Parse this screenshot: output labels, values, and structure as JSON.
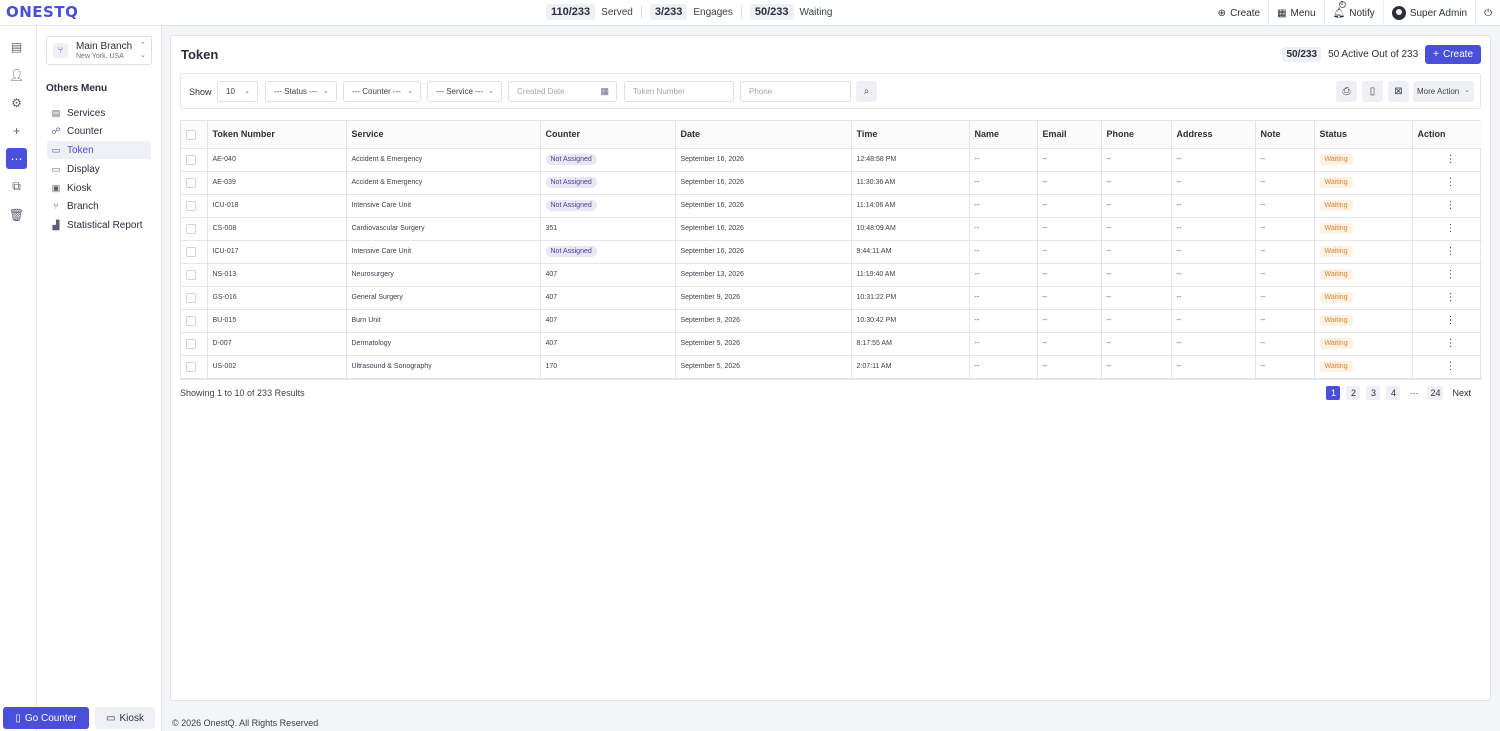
{
  "app": {
    "logo": "ONESTQ"
  },
  "topbar": {
    "stats": [
      {
        "value": "110/233",
        "label": "Served"
      },
      {
        "value": "3/233",
        "label": "Engages"
      },
      {
        "value": "50/233",
        "label": "Waiting"
      }
    ],
    "actions": {
      "create": "Create",
      "menu": "Menu",
      "notify": "Notify",
      "notify_count": "0",
      "user": "Super Admin"
    }
  },
  "branch": {
    "name": "Main Branch",
    "location": "New York, USA"
  },
  "sidebar": {
    "heading": "Others Menu",
    "items": [
      {
        "label": "Services",
        "icon": "services-icon"
      },
      {
        "label": "Counter",
        "icon": "counter-icon"
      },
      {
        "label": "Token",
        "icon": "token-icon",
        "active": true
      },
      {
        "label": "Display",
        "icon": "display-icon"
      },
      {
        "label": "Kiosk",
        "icon": "kiosk-icon"
      },
      {
        "label": "Branch",
        "icon": "branch-icon"
      },
      {
        "label": "Statistical Report",
        "icon": "report-icon"
      }
    ],
    "go_counter": "Go Counter",
    "kiosk": "Kiosk"
  },
  "page": {
    "title": "Token",
    "active_count": "50/233",
    "active_label": "50 Active Out of 233",
    "create": "Create"
  },
  "filters": {
    "show_label": "Show",
    "show_value": "10",
    "status": "--- Status ---",
    "counter": "--- Counter ---",
    "service": "--- Service ---",
    "created_date_placeholder": "Created Date",
    "token_placeholder": "Token Number",
    "phone_placeholder": "Phone",
    "more_action": "More Action"
  },
  "table": {
    "columns": [
      "Token Number",
      "Service",
      "Counter",
      "Date",
      "Time",
      "Name",
      "Email",
      "Phone",
      "Address",
      "Note",
      "Status",
      "Action"
    ],
    "rows": [
      {
        "token": "AE-040",
        "service": "Accident & Emergency",
        "counter": "Not Assigned",
        "date": "September 16, 2026",
        "time": "12:48:58 PM",
        "name": "--",
        "email": "--",
        "phone": "--",
        "address": "--",
        "note": "--",
        "status": "Waiting"
      },
      {
        "token": "AE-039",
        "service": "Accident & Emergency",
        "counter": "Not Assigned",
        "date": "September 16, 2026",
        "time": "11:30:36 AM",
        "name": "--",
        "email": "--",
        "phone": "--",
        "address": "--",
        "note": "--",
        "status": "Waiting"
      },
      {
        "token": "ICU-018",
        "service": "Intensive Care Unit",
        "counter": "Not Assigned",
        "date": "September 16, 2026",
        "time": "11:14:06 AM",
        "name": "--",
        "email": "--",
        "phone": "--",
        "address": "--",
        "note": "--",
        "status": "Waiting"
      },
      {
        "token": "CS-008",
        "service": "Cardiovascular Surgery",
        "counter": "351",
        "date": "September 16, 2026",
        "time": "10:48:09 AM",
        "name": "--",
        "email": "--",
        "phone": "--",
        "address": "--",
        "note": "--",
        "status": "Waiting"
      },
      {
        "token": "ICU-017",
        "service": "Intensive Care Unit",
        "counter": "Not Assigned",
        "date": "September 16, 2026",
        "time": "9:44:11 AM",
        "name": "--",
        "email": "--",
        "phone": "--",
        "address": "--",
        "note": "--",
        "status": "Waiting"
      },
      {
        "token": "NS-013",
        "service": "Neurosurgery",
        "counter": "407",
        "date": "September 13, 2026",
        "time": "11:19:40 AM",
        "name": "--",
        "email": "--",
        "phone": "--",
        "address": "--",
        "note": "--",
        "status": "Waiting"
      },
      {
        "token": "GS-016",
        "service": "General Surgery",
        "counter": "407",
        "date": "September 9, 2026",
        "time": "10:31:22 PM",
        "name": "--",
        "email": "--",
        "phone": "--",
        "address": "--",
        "note": "--",
        "status": "Waiting"
      },
      {
        "token": "BU-015",
        "service": "Burn Unit",
        "counter": "407",
        "date": "September 9, 2026",
        "time": "10:30:42 PM",
        "name": "--",
        "email": "--",
        "phone": "--",
        "address": "--",
        "note": "--",
        "status": "Waiting"
      },
      {
        "token": "D-007",
        "service": "Dermatology",
        "counter": "407",
        "date": "September 5, 2026",
        "time": "8:17:55 AM",
        "name": "--",
        "email": "--",
        "phone": "--",
        "address": "--",
        "note": "--",
        "status": "Waiting"
      },
      {
        "token": "US-002",
        "service": "Ultrasound & Sonography",
        "counter": "170",
        "date": "September 5, 2026",
        "time": "2:07:11 AM",
        "name": "--",
        "email": "--",
        "phone": "--",
        "address": "--",
        "note": "--",
        "status": "Waiting"
      }
    ]
  },
  "pagination": {
    "summary": "Showing 1 to 10 of 233 Results",
    "pages": [
      "1",
      "2",
      "3",
      "4"
    ],
    "ellipsis": "···",
    "last": "24",
    "next": "Next"
  },
  "footer": {
    "copyright": "© 2026 OnestQ. All Rights Reserved"
  },
  "colors": {
    "accent": "#4a4fd9",
    "status_waiting": "#d9862b",
    "badge_not_assigned": "#e9e6f6"
  }
}
